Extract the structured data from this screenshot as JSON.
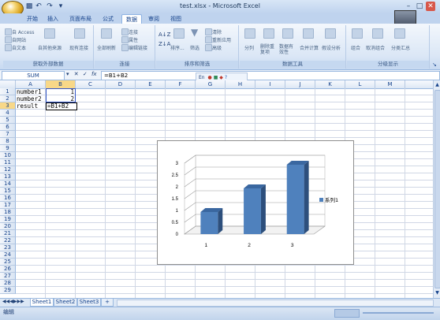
{
  "window": {
    "title": "test.xlsx - Microsoft Excel"
  },
  "qat": [
    "save-icon",
    "undo-icon",
    "redo-icon",
    "customize-icon"
  ],
  "tabs": [
    {
      "label": "开始"
    },
    {
      "label": "插入"
    },
    {
      "label": "页面布局"
    },
    {
      "label": "公式"
    },
    {
      "label": "数据",
      "active": true
    },
    {
      "label": "审阅"
    },
    {
      "label": "视图"
    }
  ],
  "ribbon": {
    "groups": [
      {
        "label": "获取外部数据",
        "items": [
          "自 Access",
          "自网站",
          "自文本",
          "自其他来源",
          "现有连接"
        ]
      },
      {
        "label": "连接",
        "items": [
          "全部刷新",
          "连接",
          "属性",
          "编辑链接"
        ]
      },
      {
        "label": "排序和筛选",
        "items": [
          "排序...",
          "筛选",
          "清除",
          "重新应用",
          "高级"
        ]
      },
      {
        "label": "数据工具",
        "items": [
          "分列",
          "删除重复项",
          "数据有效性",
          "合并计算",
          "假设分析"
        ]
      },
      {
        "label": "分级显示",
        "items": [
          "组合",
          "取消组合",
          "分类汇总"
        ]
      }
    ]
  },
  "formula": {
    "namebox": "SUM",
    "fx": "fx",
    "content": "=B1+B2"
  },
  "minitoolbar": {
    "lang": "En"
  },
  "columns": [
    "A",
    "B",
    "C",
    "D",
    "E",
    "F",
    "G",
    "H",
    "I",
    "J",
    "K",
    "L",
    "M"
  ],
  "rows": [
    "1",
    "2",
    "3",
    "4",
    "5",
    "6",
    "7",
    "8",
    "9",
    "10",
    "11",
    "12",
    "13",
    "14",
    "15",
    "16",
    "17",
    "18",
    "19",
    "20",
    "21",
    "22",
    "23",
    "24",
    "25",
    "26",
    "27",
    "28",
    "29"
  ],
  "cells": {
    "A1": "number1",
    "B1": "1",
    "A2": "number2",
    "B2": "2",
    "A3": "result",
    "B3": "=B1+B2"
  },
  "sheets": [
    {
      "label": "Sheet1",
      "active": true
    },
    {
      "label": "Sheet2"
    },
    {
      "label": "Sheet3"
    }
  ],
  "status": {
    "mode": "编辑"
  },
  "chart_data": {
    "type": "bar",
    "categories": [
      "1",
      "2",
      "3"
    ],
    "series": [
      {
        "name": "系列1",
        "values": [
          1,
          2,
          3
        ],
        "color": "#4f81bd"
      }
    ],
    "ylim": [
      0,
      3
    ],
    "yticks": [
      "0",
      "0.5",
      "1",
      "1.5",
      "2",
      "2.5",
      "3"
    ],
    "legend": "right",
    "grid": true
  }
}
